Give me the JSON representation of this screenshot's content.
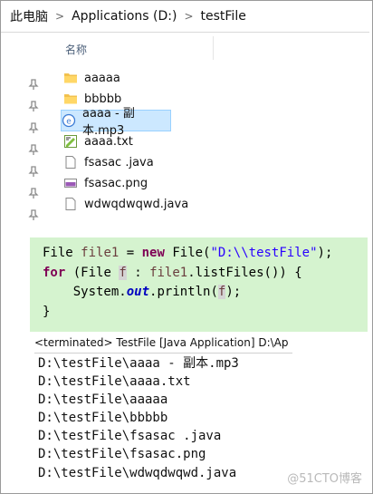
{
  "breadcrumb": {
    "items": [
      "此电脑",
      "Applications (D:)",
      "testFile"
    ]
  },
  "columns": {
    "name": "名称"
  },
  "files": [
    {
      "name": "aaaaa",
      "icon": "folder-icon"
    },
    {
      "name": "bbbbb",
      "icon": "folder-icon"
    },
    {
      "name": "aaaa - 副本.mp3",
      "icon": "audio-file-icon",
      "selected": true
    },
    {
      "name": "aaaa.txt",
      "icon": "text-file-icon"
    },
    {
      "name": "fsasac .java",
      "icon": "file-icon"
    },
    {
      "name": "fsasac.png",
      "icon": "image-file-icon"
    },
    {
      "name": "wdwqdwqwd.java",
      "icon": "file-icon"
    }
  ],
  "code": {
    "type_file": "File",
    "var_file1": "file1",
    "kw_new": "new",
    "ctor": "File(",
    "path_literal": "\"D:\\\\testFile\"",
    "end1": ");",
    "kw_for": "for",
    "for_open": "(File",
    "var_f": "f",
    "colon": ":",
    "list_call": ".listFiles()) {",
    "system": "System.",
    "out": "out",
    "println": ".println(",
    "end3": ");",
    "close": "}"
  },
  "console": {
    "header": "<terminated> TestFile [Java Application] D:\\Ap",
    "lines": [
      "D:\\testFile\\aaaa - 副本.mp3",
      "D:\\testFile\\aaaa.txt",
      "D:\\testFile\\aaaaa",
      "D:\\testFile\\bbbbb",
      "D:\\testFile\\fsasac .java",
      "D:\\testFile\\fsasac.png",
      "D:\\testFile\\wdwqdwqwd.java"
    ]
  },
  "watermark": "@51CTO博客"
}
